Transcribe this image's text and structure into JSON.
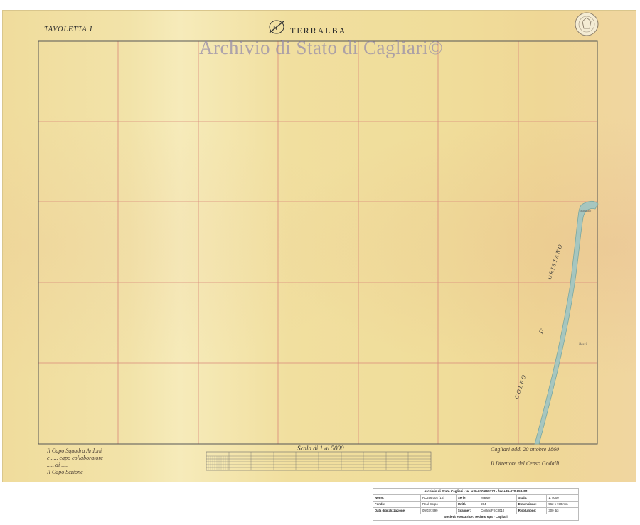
{
  "map": {
    "sheet_label": "TAVOLETTA I",
    "place_name": "TERRALBA",
    "watermark": "Archivio di Stato di Cagliari©",
    "sea_label_words": [
      "GOLFO",
      "D'",
      "ORISTANO"
    ],
    "scale_label": "Scala di 1 al 5000",
    "colors": {
      "paper": "#f1df9f",
      "grid": "#d9887a",
      "frame": "#5a5a5a",
      "coast": "#9ec3bd"
    }
  },
  "signatures": {
    "left": [
      "Il Capo Squadra Ardoni",
      "e  ..... capo collaboratore",
      "..... di .....",
      "Il Capo Sezione"
    ],
    "right": [
      "Cagliari addì 20 ottobre 1860",
      "..... ..... ..... .....",
      "Il Direttore del Censo Godalli"
    ]
  },
  "info_card": {
    "header": "Archivio di Stato Cagliari - tel. +39-070.665772 - fax +39-070.653401",
    "rows": [
      [
        "Nome:",
        "RC256.004 (1B)",
        "Serie:",
        "Mappe",
        "Scala:",
        "1: 5000"
      ],
      [
        "Fondo:",
        "Real Corpo",
        "Unità:",
        "284",
        "Dimensione:",
        "562 x 730 mm"
      ],
      [
        "Data digitalizzazione:",
        "09/03/1999",
        "Scanner:",
        "Contex FSC8010",
        "Risoluzione:",
        "300 dpi"
      ]
    ],
    "footer": "Società esecutrice: Techno spa - Cagliari"
  }
}
